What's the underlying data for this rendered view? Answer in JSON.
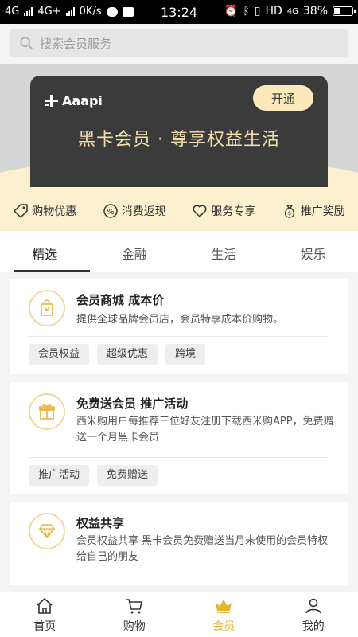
{
  "status": {
    "net1": "4G",
    "net2": "4G+",
    "speed": "0K/s",
    "time": "13:24",
    "hd": "HD",
    "net3": "4G",
    "battery": "38%"
  },
  "search": {
    "placeholder": "搜索会员服务"
  },
  "card": {
    "brand": "Aaapi",
    "open_label": "开通",
    "slogan": "黑卡会员 · 尊享权益生活"
  },
  "perks": [
    "购物优惠",
    "消费返现",
    "服务专享",
    "推广奖励"
  ],
  "tabs": [
    "精选",
    "金融",
    "生活",
    "娱乐"
  ],
  "items": [
    {
      "title": "会员商城 成本价",
      "desc": "提供全球品牌会员店，会员特享成本价购物。",
      "tags": [
        "会员权益",
        "超级优惠",
        "跨境"
      ]
    },
    {
      "title": "免费送会员 推广活动",
      "desc": "西米购用户每推荐三位好友注册下载西米购APP，免费赠送一个月黑卡会员",
      "tags": [
        "推广活动",
        "免费赠送"
      ]
    },
    {
      "title": "权益共享",
      "desc": "会员权益共享 黑卡会员免费赠送当月未使用的会员特权给自己的朋友"
    }
  ],
  "nav": [
    "首页",
    "购物",
    "会员",
    "我的"
  ],
  "colors": {
    "accent": "#e5b339",
    "card": "#3b3b3b",
    "cream": "#fcf0cf"
  }
}
